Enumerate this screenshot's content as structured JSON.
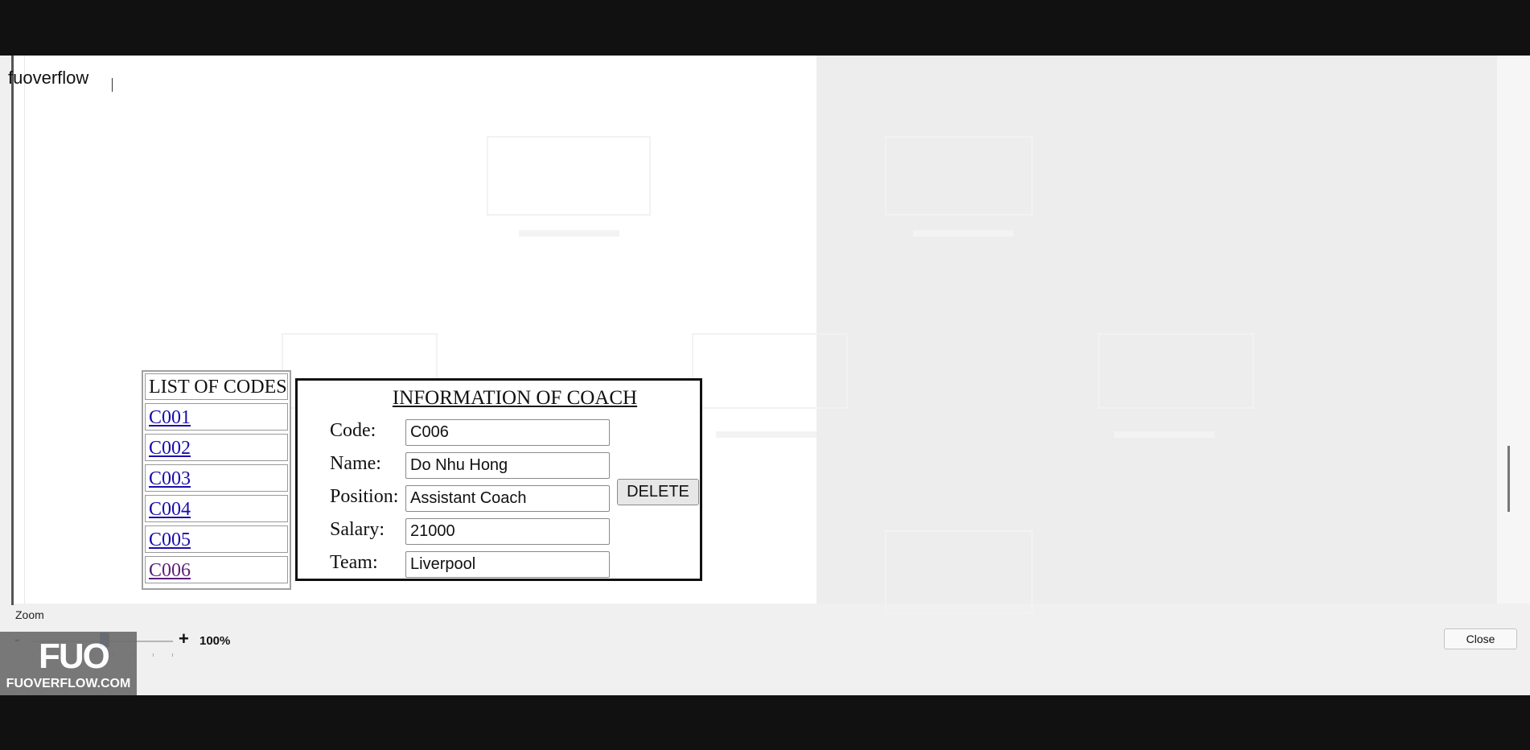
{
  "app": {
    "title": "fuoverflow"
  },
  "codes_panel": {
    "header": "LIST OF CODES",
    "items": [
      "C001",
      "C002",
      "C003",
      "C004",
      "C005",
      "C006"
    ]
  },
  "arrow_text": "-->",
  "info_panel": {
    "heading": "INFORMATION OF COACH",
    "code_label": "Code:",
    "code_value": "C006",
    "name_label": "Name:",
    "name_value": "Do Nhu Hong",
    "position_label": "Position:",
    "position_value": "Assistant Coach",
    "salary_label": "Salary:",
    "salary_value": "21000",
    "team_label": "Team:",
    "team_value": "Liverpool",
    "delete_label": "DELETE"
  },
  "zoom": {
    "label": "Zoom",
    "minus": "-",
    "plus": "+",
    "value_text": "100%"
  },
  "close_label": "Close",
  "watermark": {
    "logo": "FUO",
    "text": "FUOVERFLOW.COM"
  },
  "colors": {
    "link": "#1a0dab",
    "visited_link": "#5c1f7a",
    "slider_thumb": "#1e5aa8"
  }
}
